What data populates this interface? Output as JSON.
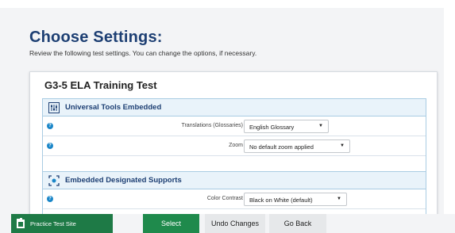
{
  "header": {
    "title": "Choose Settings:",
    "subtitle": "Review the following test settings. You can change the options, if necessary."
  },
  "test": {
    "name": "G3-5 ELA Training Test"
  },
  "sections": {
    "universal": {
      "label": "Universal Tools Embedded",
      "rows": [
        {
          "label": "Translations (Glossaries)",
          "value": "English Glossary"
        },
        {
          "label": "Zoom",
          "value": "No default zoom applied"
        }
      ]
    },
    "designated": {
      "label": "Embedded Designated Supports",
      "rows": [
        {
          "label": "Color Contrast",
          "value": "Black on White (default)"
        }
      ]
    }
  },
  "info_icon_glyph": "?",
  "dropdown_caret": "▼",
  "footer": {
    "practice_label": "Practice Test Site",
    "select_label": "Select",
    "undo_label": "Undo Changes",
    "back_label": "Go Back"
  },
  "colors": {
    "title": "#1d3f73",
    "accent_green": "#1f8a4c",
    "section_border": "#a9cce3",
    "info_blue": "#1a86c8"
  }
}
